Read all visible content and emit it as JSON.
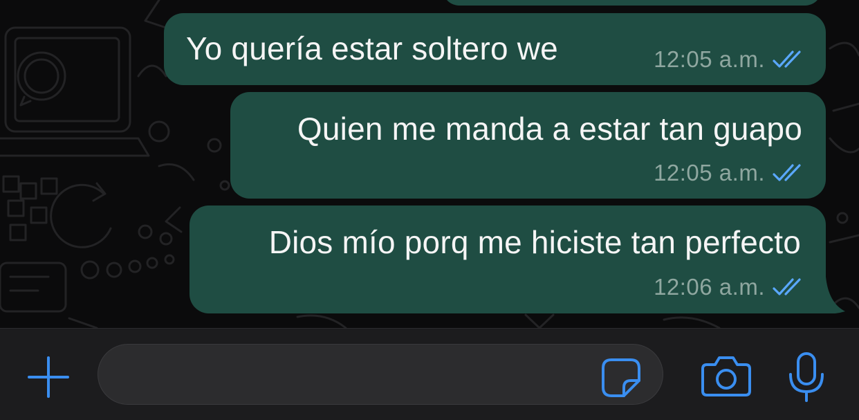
{
  "messages": [
    {
      "text": "Yo quería estar soltero we",
      "time": "12:05 a.m.",
      "status": "read"
    },
    {
      "text": "Quien me manda a estar tan guapo",
      "time": "12:05 a.m.",
      "status": "read"
    },
    {
      "text": "Dios mío porq me hiciste tan perfecto",
      "time": "12:06 a.m.",
      "status": "read"
    }
  ],
  "composer": {
    "message_value": "",
    "attach_icon": "plus-icon",
    "sticker_icon": "sticker-icon",
    "camera_icon": "camera-icon",
    "mic_icon": "microphone-icon"
  },
  "colors": {
    "background": "#0b0b0c",
    "outgoing_bubble": "#1f4d43",
    "read_ticks": "#5aa8ff",
    "accent": "#3a8ef0",
    "input_bar": "#1c1c1e"
  }
}
